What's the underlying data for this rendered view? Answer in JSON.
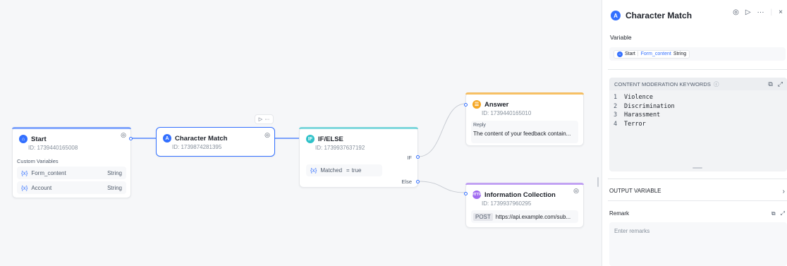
{
  "nodes": {
    "start": {
      "title": "Start",
      "id": "ID: 1739440165008",
      "section": "Custom Variables",
      "vars": [
        {
          "name": "Form_content",
          "type": "String"
        },
        {
          "name": "Account",
          "type": "String"
        }
      ]
    },
    "character_match": {
      "title": "Character Match",
      "id": "ID: 1739874281395"
    },
    "ifelse": {
      "title": "IF/ELSE",
      "id": "ID: 1739937637192",
      "if_label": "IF",
      "else_label": "Else",
      "condition": {
        "var": "Matched",
        "op": "=",
        "value": "true"
      }
    },
    "answer": {
      "title": "Answer",
      "id": "ID: 1739440165010",
      "reply_label": "Reply",
      "reply_text": "The content of your feedback contain..."
    },
    "info": {
      "title": "Information Collection",
      "id": "ID: 1739937960295",
      "method": "POST",
      "url": "https://api.example.com/sub..."
    }
  },
  "panel": {
    "title": "Character Match",
    "variable_label": "Variable",
    "chip": {
      "node": "Start",
      "var": "Form_content",
      "type": "String"
    },
    "keywords_label": "CONTENT MODERATION KEYWORDS",
    "keywords": [
      {
        "n": "1",
        "text": "Violence"
      },
      {
        "n": "2",
        "text": "Discrimination"
      },
      {
        "n": "3",
        "text": "Harassment"
      },
      {
        "n": "4",
        "text": "Terror"
      }
    ],
    "output_label": "OUTPUT VARIABLE",
    "remark_label": "Remark",
    "remark_placeholder": "Enter remarks"
  },
  "colors": {
    "accent": "#3370ff",
    "teal": "#2fc2c9",
    "orange": "#f5a623",
    "purple": "#a06bf0"
  }
}
